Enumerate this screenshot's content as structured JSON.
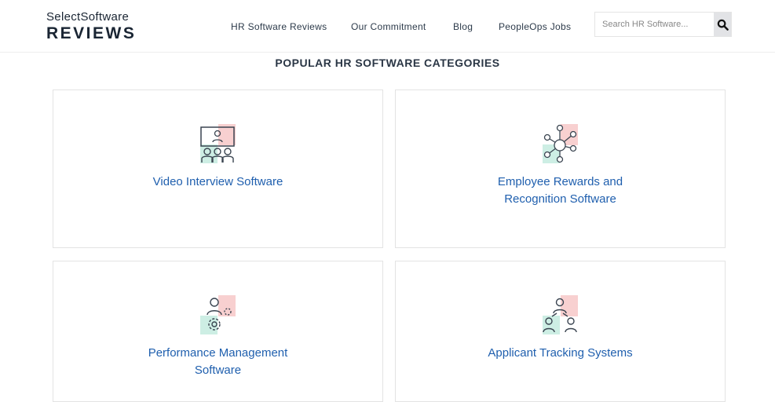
{
  "header": {
    "logo_line1": "SelectSoftware",
    "logo_line2": "REVIEWS",
    "nav": [
      "HR Software Reviews",
      "Our Commitment",
      "Blog",
      "PeopleOps Jobs"
    ],
    "search_placeholder": "Search HR Software...",
    "search_icon": "search-icon"
  },
  "section_title": "POPULAR HR SOFTWARE CATEGORIES",
  "categories": [
    {
      "label": "Video Interview Software",
      "icon": "video-interview-icon"
    },
    {
      "label": "Employee Rewards and Recognition Software",
      "icon": "network-icon"
    },
    {
      "label": "Performance Management Software",
      "icon": "performance-gear-icon"
    },
    {
      "label": "Applicant Tracking Systems",
      "icon": "applicant-tracking-icon"
    }
  ],
  "colors": {
    "link": "#1f5fae",
    "pink": "#f8d0d0",
    "mint": "#cdeee4"
  }
}
